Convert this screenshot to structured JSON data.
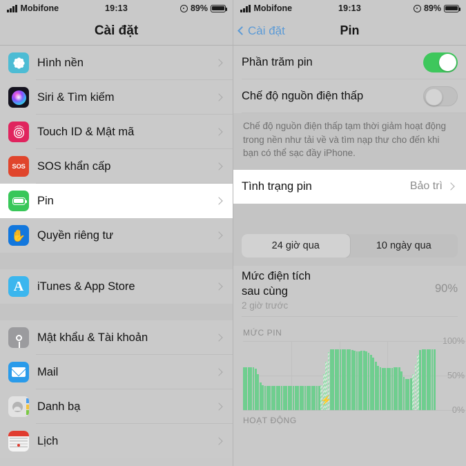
{
  "status_bar": {
    "carrier": "Mobifone",
    "time": "19:13",
    "battery_percent": "89%",
    "signal_icon": "signal-bars-icon",
    "location_icon": "location-services-icon",
    "battery_icon": "battery-icon"
  },
  "left_screen": {
    "nav": {
      "title": "Cài đặt"
    },
    "groups": [
      {
        "items": [
          {
            "label": "Hình nền",
            "icon": "wallpaper-icon",
            "selected": false
          },
          {
            "label": "Siri & Tìm kiếm",
            "icon": "siri-icon",
            "selected": false
          },
          {
            "label": "Touch ID & Mật mã",
            "icon": "touchid-icon",
            "selected": false
          },
          {
            "label": "SOS khẩn cấp",
            "icon": "sos-icon",
            "selected": false
          },
          {
            "label": "Pin",
            "icon": "battery-settings-icon",
            "selected": true
          },
          {
            "label": "Quyền riêng tư",
            "icon": "privacy-hand-icon",
            "selected": false
          }
        ]
      },
      {
        "items": [
          {
            "label": "iTunes & App Store",
            "icon": "app-store-icon",
            "selected": false
          }
        ]
      },
      {
        "items": [
          {
            "label": "Mật khẩu & Tài khoản",
            "icon": "passwords-key-icon",
            "selected": false
          },
          {
            "label": "Mail",
            "icon": "mail-icon",
            "selected": false
          },
          {
            "label": "Danh bạ",
            "icon": "contacts-icon",
            "selected": false
          },
          {
            "label": "Lịch",
            "icon": "calendar-icon",
            "selected": false
          }
        ]
      }
    ]
  },
  "right_screen": {
    "nav": {
      "back_label": "Cài đặt",
      "title": "Pin",
      "back_icon": "chevron-left-icon"
    },
    "toggles": [
      {
        "label": "Phần trăm pin",
        "state": "on"
      },
      {
        "label": "Chế độ nguồn điện thấp",
        "state": "off"
      }
    ],
    "description": "Chế độ nguồn điện thấp tạm thời giảm hoạt động trong nền như tải về và tìm nạp thư cho đến khi bạn có thể sạc đầy iPhone.",
    "battery_health": {
      "label": "Tình trạng pin",
      "value": "Bảo trì",
      "chevron": "chevron-right-icon"
    },
    "segments": [
      {
        "label": "24 giờ qua",
        "active": true
      },
      {
        "label": "10 ngày qua",
        "active": false
      }
    ],
    "last_charge": {
      "title_line1": "Mức điện tích",
      "title_line2": "sau cùng",
      "percent": "90%",
      "subtitle": "2 giờ trước"
    },
    "activity_header": "HOẠT ĐỘNG"
  },
  "chart_data": {
    "type": "bar",
    "title": "MỨC PIN",
    "xlabel": "",
    "ylabel": "",
    "ylim": [
      0,
      100
    ],
    "ytick_labels": [
      "0%",
      "50%",
      "100%"
    ],
    "ytick_values": [
      0,
      50,
      100
    ],
    "grid": true,
    "legend_position": "none",
    "annotations": [
      {
        "type": "charging-bolt-icon",
        "at_index": 33,
        "label": "⚡"
      }
    ],
    "series": [
      {
        "name": "Mức pin",
        "values": [
          62,
          62,
          62,
          62,
          62,
          60,
          52,
          40,
          36,
          35,
          35,
          35,
          35,
          35,
          35,
          35,
          35,
          35,
          35,
          35,
          35,
          35,
          35,
          35,
          35,
          35,
          35,
          35,
          35,
          35,
          35,
          35,
          35,
          36,
          52,
          70,
          84,
          88,
          88,
          88,
          88,
          88,
          88,
          88,
          88,
          88,
          87,
          86,
          85,
          85,
          86,
          86,
          85,
          83,
          80,
          76,
          70,
          64,
          62,
          61,
          61,
          61,
          61,
          61,
          62,
          62,
          62,
          56,
          48,
          45,
          45,
          46,
          52,
          66,
          80,
          87,
          88,
          88,
          88,
          88,
          88,
          88
        ],
        "charging_indices": [
          33,
          34,
          35,
          36,
          72,
          73,
          74
        ]
      }
    ]
  }
}
